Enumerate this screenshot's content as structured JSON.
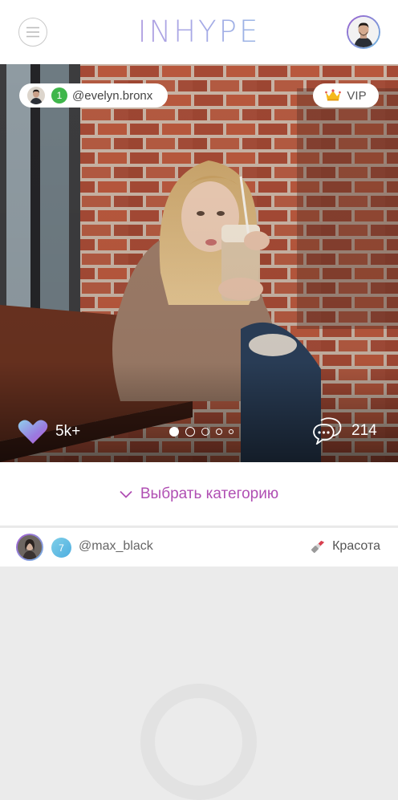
{
  "header": {
    "logo": "INHYPE",
    "menu_icon": "menu-icon",
    "avatar_icon": "profile-avatar"
  },
  "post": {
    "author": {
      "level": "1",
      "username": "@evelyn.bronx",
      "level_color": "#3fb64b"
    },
    "vip_label": "VIP",
    "likes": "5k+",
    "comments": "214",
    "carousel": {
      "count": 5,
      "active_index": 0
    }
  },
  "category_selector": {
    "label": "Выбрать категорию",
    "accent": "#b04fb3"
  },
  "next_post": {
    "level": "7",
    "username": "@max_black",
    "category": "Красота"
  }
}
